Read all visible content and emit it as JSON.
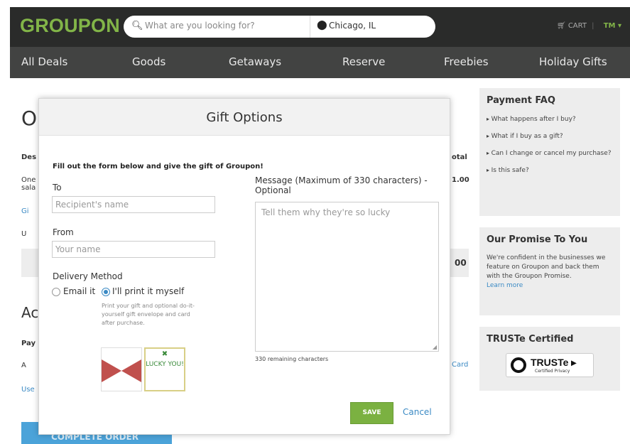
{
  "header": {
    "logo": "GROUPON",
    "search_placeholder": "What are you looking for?",
    "location": "Chicago, IL",
    "cart_label": "CART",
    "user_initials": "TM ▾"
  },
  "nav": [
    "All Deals",
    "Goods",
    "Getaways",
    "Reserve",
    "Freebies",
    "Holiday Gifts"
  ],
  "background": {
    "title_letter": "O",
    "desc_frag": "Des",
    "one_frag": "One",
    "sala_frag": "sala",
    "gi_frag": "Gi",
    "u_frag": "U",
    "ac_frag": "Ac",
    "pay_frag": "Pay",
    "a_frag": "A",
    "use_frag": "Use",
    "total_frag": "otal",
    "price_frag": "1.00",
    "price2_frag": "00",
    "card_frag": "Card",
    "complete_order": "COMPLETE ORDER"
  },
  "sidebar": {
    "faq_title": "Payment FAQ",
    "faq_items": [
      "What happens after I buy?",
      "What if I buy as a gift?",
      "Can I change or cancel my purchase?",
      "Is this safe?"
    ],
    "promise_title": "Our Promise To You",
    "promise_text": "We're confident in the businesses we feature on Groupon and back them with the Groupon Promise.",
    "promise_link": "Learn more",
    "truste_title": "TRUSTe Certified",
    "truste_logo": "TRUSTe ▸",
    "truste_sub": "Certified Privacy"
  },
  "modal": {
    "title": "Gift Options",
    "intro": "Fill out the form below and give the gift of Groupon!",
    "to_label": "To",
    "to_placeholder": "Recipient's name",
    "from_label": "From",
    "from_placeholder": "Your name",
    "delivery_label": "Delivery Method",
    "option_email": "Email it",
    "option_print": "I'll print it myself",
    "selected_option": "print",
    "print_note": "Print your gift and optional do-it-yourself gift envelope and card after purchase.",
    "message_label": "Message (Maximum of 330 characters) - Optional",
    "message_placeholder": "Tell them why they're so lucky",
    "remaining": "330 remaining characters",
    "card_text": "LUCKY YOU!",
    "save_label": "SAVE",
    "cancel_label": "Cancel"
  },
  "colors": {
    "brand_green": "#82b548",
    "link_blue": "#3b8ac4",
    "header_dark": "#2a2b2a",
    "nav_grey": "#424342"
  }
}
